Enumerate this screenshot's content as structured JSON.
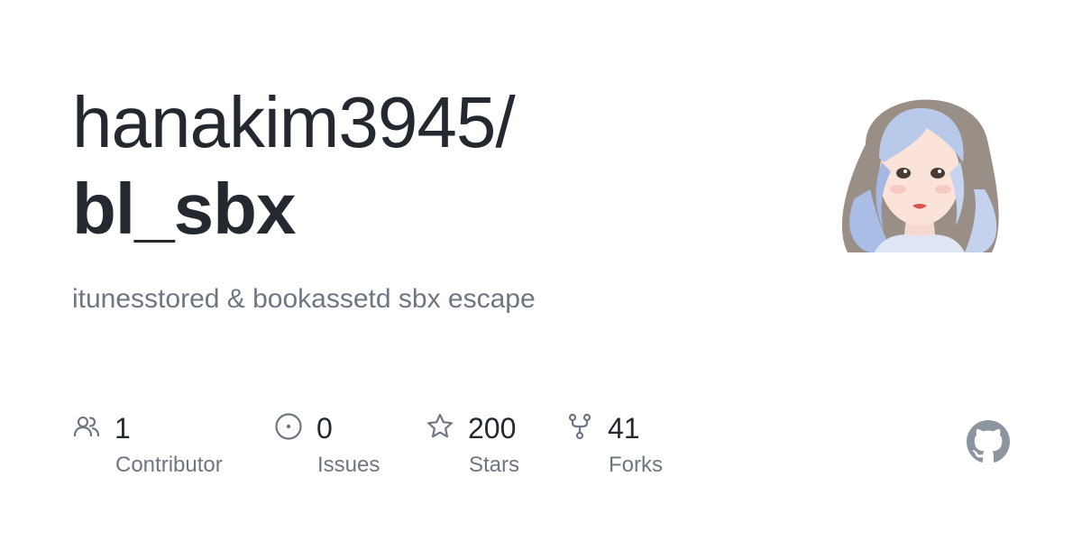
{
  "repo": {
    "owner": "hanakim3945/",
    "name": "bl_sbx",
    "description": "itunesstored & bookassetd sbx escape"
  },
  "stats": [
    {
      "value": "1",
      "label": "Contributor",
      "icon": "people-icon"
    },
    {
      "value": "0",
      "label": "Issues",
      "icon": "issue-icon"
    },
    {
      "value": "200",
      "label": "Stars",
      "icon": "star-icon"
    },
    {
      "value": "41",
      "label": "Forks",
      "icon": "fork-icon"
    }
  ],
  "brand": {
    "logo": "github-logo-icon"
  },
  "avatar": {
    "icon": "owner-avatar"
  },
  "colors": {
    "text_primary": "#24292f",
    "text_secondary": "#6e7781",
    "icon_gray": "#6e7781",
    "logo_gray": "#8c959f",
    "avatar_hair": "#b7c6e8"
  }
}
